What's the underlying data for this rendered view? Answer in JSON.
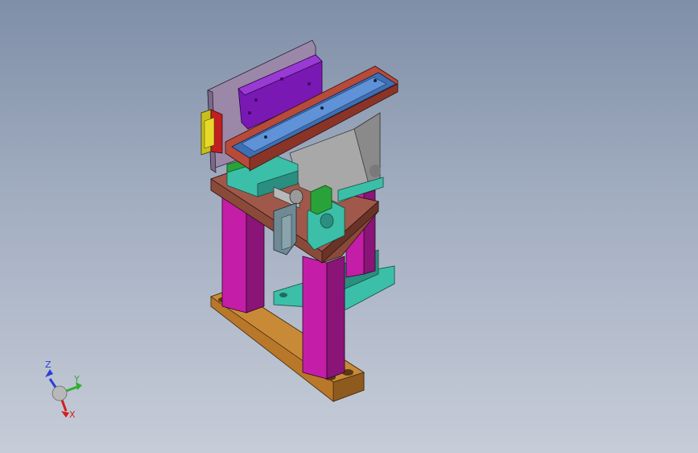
{
  "viewport": {
    "background_top": "#7f8fa8",
    "background_bottom": "#c6ccd8"
  },
  "model": {
    "colors": {
      "base_plate": "#b9772a",
      "column": "#c41ea8",
      "back_plate": "#9b88a8",
      "purple_block": "#7a18b4",
      "rail_red": "#b84a3a",
      "rail_blue": "#3d6fb3",
      "housing_gray": "#a8a8a8",
      "teal_block": "#3bbfa8",
      "green_block": "#29a23a",
      "clamp_gray": "#6f8a94",
      "red_block": "#c02020",
      "yellow_block": "#c8c01a",
      "brown_plate": "#8a4a3a"
    }
  },
  "triad": {
    "z_label": "Z",
    "y_label": "Y",
    "x_label": "X",
    "z_color": "#2a3fd8",
    "y_color": "#2fb02f",
    "x_color": "#d02020",
    "sphere_color": "#b8b8b8"
  }
}
